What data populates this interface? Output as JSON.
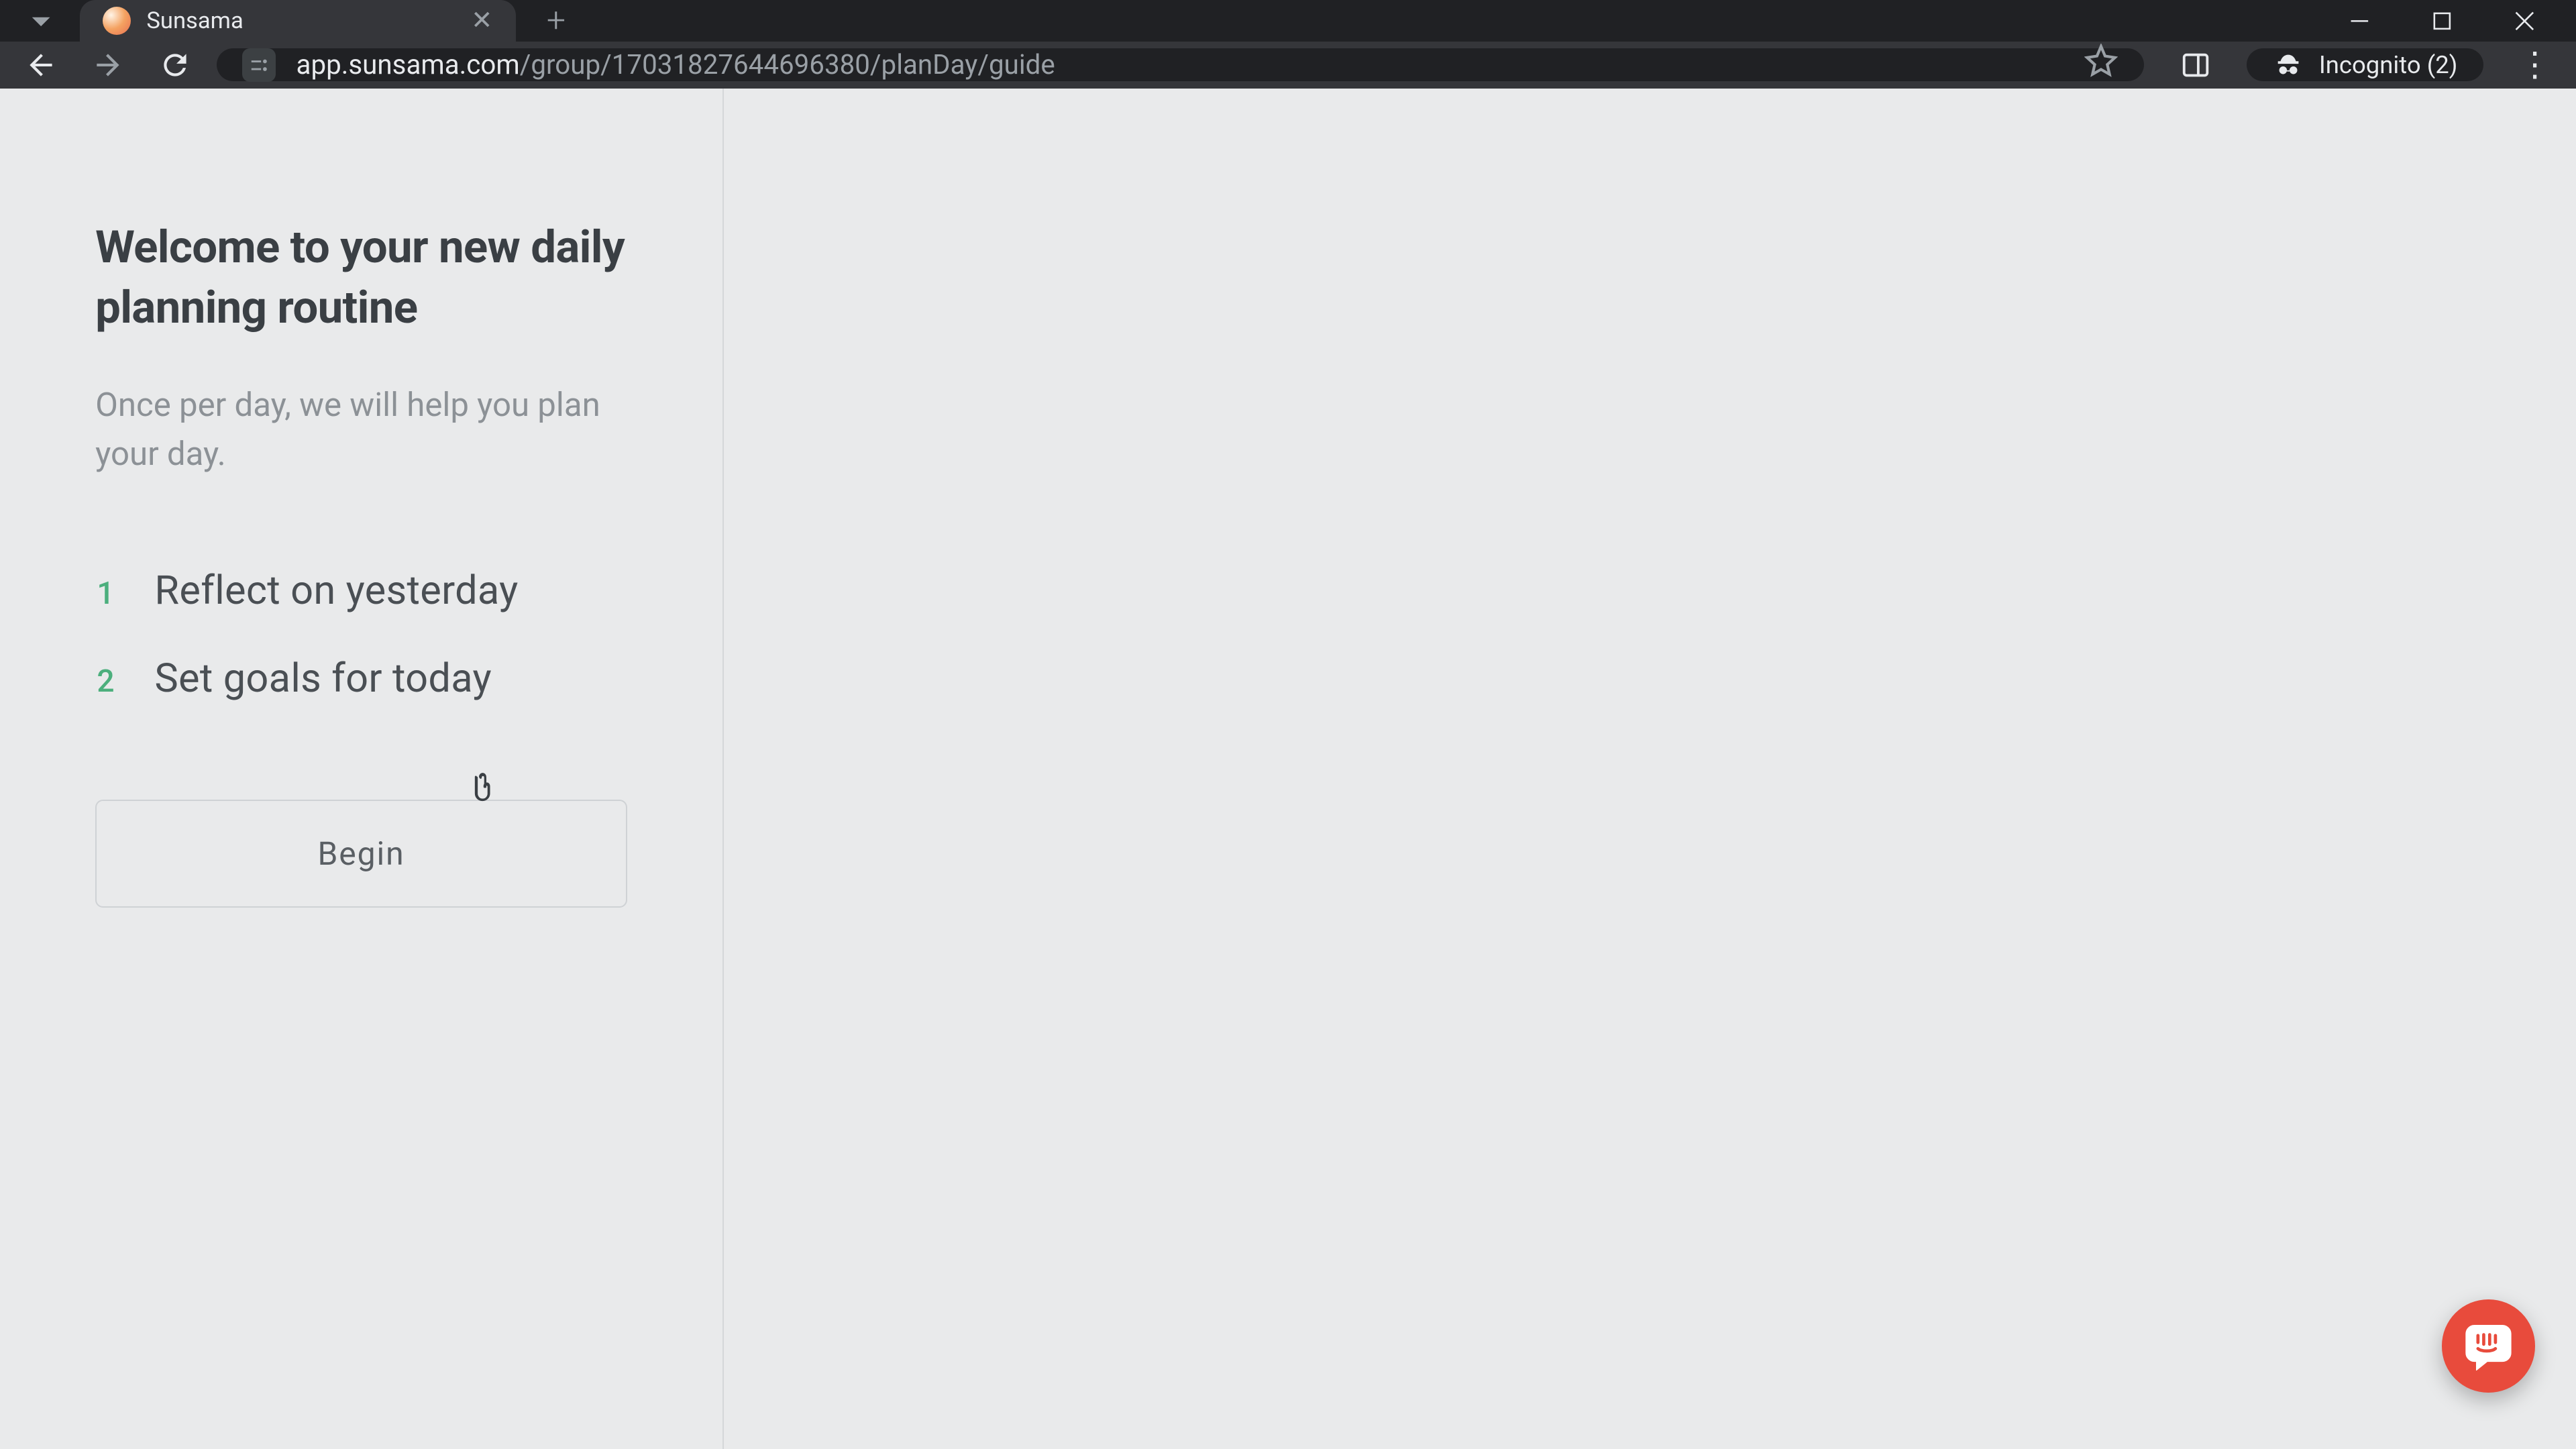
{
  "browser": {
    "tab_title": "Sunsama",
    "url_host": "app.sunsama.com",
    "url_path": "/group/17031827644696380/planDay/guide",
    "incognito_label": "Incognito (2)"
  },
  "page": {
    "title": "Welcome to your new daily planning routine",
    "subtitle": "Once per day, we will help you plan your day.",
    "steps": [
      {
        "num": "1",
        "label": "Reflect on yesterday"
      },
      {
        "num": "2",
        "label": "Set goals for today"
      }
    ],
    "begin_label": "Begin"
  }
}
